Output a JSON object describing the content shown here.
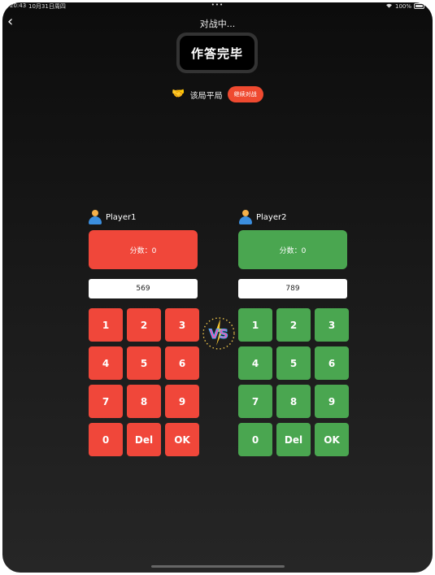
{
  "status_bar": {
    "time": "20:43",
    "date": "10月31日周四",
    "dots": "•••",
    "battery_text": "100%"
  },
  "nav": {
    "back_glyph": "‹",
    "title": "对战中..."
  },
  "banner": {
    "label": "作答完毕"
  },
  "result": {
    "icon": "handshake-icon",
    "text": "该局平局",
    "continue_label": "继续对战"
  },
  "players": [
    {
      "name": "Player1",
      "score_text": "分数：0",
      "answer": "569",
      "color": "#f0473a",
      "keys": [
        "1",
        "2",
        "3",
        "4",
        "5",
        "6",
        "7",
        "8",
        "9",
        "0",
        "Del",
        "OK"
      ]
    },
    {
      "name": "Player2",
      "score_text": "分数：0",
      "answer": "789",
      "color": "#4aa650",
      "keys": [
        "1",
        "2",
        "3",
        "4",
        "5",
        "6",
        "7",
        "8",
        "9",
        "0",
        "Del",
        "OK"
      ]
    }
  ],
  "vs_label": "VS"
}
